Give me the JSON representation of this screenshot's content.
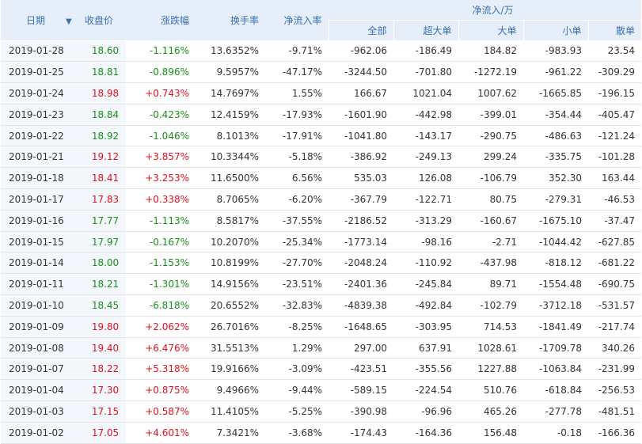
{
  "headers": {
    "date": "日期",
    "sort_icon": "arrow-down-icon",
    "close": "收盘价",
    "change": "涨跌幅",
    "turnover": "换手率",
    "netflow_rate": "净流入率",
    "netflow_group": "净流入/万",
    "total": "全部",
    "super_large": "超大单",
    "large": "大单",
    "small": "小单",
    "retail": "散单"
  },
  "colors": {
    "up": "#e0121f",
    "down": "#188f18",
    "header_bg": "#e6eff9",
    "header_text": "#3a6fb4"
  },
  "rows": [
    {
      "date": "2019-01-28",
      "close": "18.60",
      "change": "-1.116%",
      "turnover": "13.6352%",
      "rate": "-9.71%",
      "total": "-962.06",
      "super": "-186.49",
      "large": "184.82",
      "small": "-983.93",
      "retail": "23.54",
      "dir": "down"
    },
    {
      "date": "2019-01-25",
      "close": "18.81",
      "change": "-0.896%",
      "turnover": "9.5957%",
      "rate": "-47.17%",
      "total": "-3244.50",
      "super": "-701.80",
      "large": "-1272.19",
      "small": "-961.22",
      "retail": "-309.29",
      "dir": "down"
    },
    {
      "date": "2019-01-24",
      "close": "18.98",
      "change": "+0.743%",
      "turnover": "14.7697%",
      "rate": "1.55%",
      "total": "166.67",
      "super": "1021.04",
      "large": "1007.62",
      "small": "-1665.85",
      "retail": "-196.15",
      "dir": "up"
    },
    {
      "date": "2019-01-23",
      "close": "18.84",
      "change": "-0.423%",
      "turnover": "12.4159%",
      "rate": "-17.93%",
      "total": "-1601.90",
      "super": "-442.98",
      "large": "-399.01",
      "small": "-354.44",
      "retail": "-405.47",
      "dir": "down"
    },
    {
      "date": "2019-01-22",
      "close": "18.92",
      "change": "-1.046%",
      "turnover": "8.1013%",
      "rate": "-17.91%",
      "total": "-1041.80",
      "super": "-143.17",
      "large": "-290.75",
      "small": "-486.63",
      "retail": "-121.24",
      "dir": "down"
    },
    {
      "date": "2019-01-21",
      "close": "19.12",
      "change": "+3.857%",
      "turnover": "10.3344%",
      "rate": "-5.18%",
      "total": "-386.92",
      "super": "-249.13",
      "large": "299.24",
      "small": "-335.75",
      "retail": "-101.28",
      "dir": "up"
    },
    {
      "date": "2019-01-18",
      "close": "18.41",
      "change": "+3.253%",
      "turnover": "11.6500%",
      "rate": "6.56%",
      "total": "535.03",
      "super": "126.08",
      "large": "-106.79",
      "small": "352.30",
      "retail": "163.44",
      "dir": "up"
    },
    {
      "date": "2019-01-17",
      "close": "17.83",
      "change": "+0.338%",
      "turnover": "8.7065%",
      "rate": "-6.20%",
      "total": "-367.79",
      "super": "-122.71",
      "large": "80.75",
      "small": "-279.31",
      "retail": "-46.53",
      "dir": "up"
    },
    {
      "date": "2019-01-16",
      "close": "17.77",
      "change": "-1.113%",
      "turnover": "8.5817%",
      "rate": "-37.55%",
      "total": "-2186.52",
      "super": "-313.29",
      "large": "-160.67",
      "small": "-1675.10",
      "retail": "-37.47",
      "dir": "down"
    },
    {
      "date": "2019-01-15",
      "close": "17.97",
      "change": "-0.167%",
      "turnover": "10.2070%",
      "rate": "-25.34%",
      "total": "-1773.14",
      "super": "-98.16",
      "large": "-2.71",
      "small": "-1044.42",
      "retail": "-627.85",
      "dir": "down"
    },
    {
      "date": "2019-01-14",
      "close": "18.00",
      "change": "-1.153%",
      "turnover": "10.8199%",
      "rate": "-27.70%",
      "total": "-2048.24",
      "super": "-110.92",
      "large": "-437.98",
      "small": "-818.12",
      "retail": "-681.22",
      "dir": "down"
    },
    {
      "date": "2019-01-11",
      "close": "18.21",
      "change": "-1.301%",
      "turnover": "14.9156%",
      "rate": "-23.51%",
      "total": "-2401.36",
      "super": "-245.84",
      "large": "89.71",
      "small": "-1554.48",
      "retail": "-690.75",
      "dir": "down"
    },
    {
      "date": "2019-01-10",
      "close": "18.45",
      "change": "-6.818%",
      "turnover": "20.6552%",
      "rate": "-32.83%",
      "total": "-4839.38",
      "super": "-492.84",
      "large": "-102.79",
      "small": "-3712.18",
      "retail": "-531.57",
      "dir": "down"
    },
    {
      "date": "2019-01-09",
      "close": "19.80",
      "change": "+2.062%",
      "turnover": "26.7016%",
      "rate": "-8.25%",
      "total": "-1648.65",
      "super": "-303.95",
      "large": "714.53",
      "small": "-1841.49",
      "retail": "-217.74",
      "dir": "up"
    },
    {
      "date": "2019-01-08",
      "close": "19.40",
      "change": "+6.476%",
      "turnover": "31.5513%",
      "rate": "1.29%",
      "total": "297.00",
      "super": "637.91",
      "large": "1028.61",
      "small": "-1709.78",
      "retail": "340.26",
      "dir": "up"
    },
    {
      "date": "2019-01-07",
      "close": "18.22",
      "change": "+5.318%",
      "turnover": "19.9166%",
      "rate": "-3.09%",
      "total": "-423.51",
      "super": "-355.56",
      "large": "1227.88",
      "small": "-1063.84",
      "retail": "-231.99",
      "dir": "up"
    },
    {
      "date": "2019-01-04",
      "close": "17.30",
      "change": "+0.875%",
      "turnover": "9.4966%",
      "rate": "-9.44%",
      "total": "-589.15",
      "super": "-224.54",
      "large": "510.76",
      "small": "-618.84",
      "retail": "-256.53",
      "dir": "up"
    },
    {
      "date": "2019-01-03",
      "close": "17.15",
      "change": "+0.587%",
      "turnover": "11.4105%",
      "rate": "-5.25%",
      "total": "-390.98",
      "super": "-96.96",
      "large": "465.26",
      "small": "-277.78",
      "retail": "-481.51",
      "dir": "up"
    },
    {
      "date": "2019-01-02",
      "close": "17.05",
      "change": "+4.601%",
      "turnover": "7.3421%",
      "rate": "-3.68%",
      "total": "-174.43",
      "super": "-164.36",
      "large": "156.48",
      "small": "-0.18",
      "retail": "-166.36",
      "dir": "up"
    }
  ]
}
